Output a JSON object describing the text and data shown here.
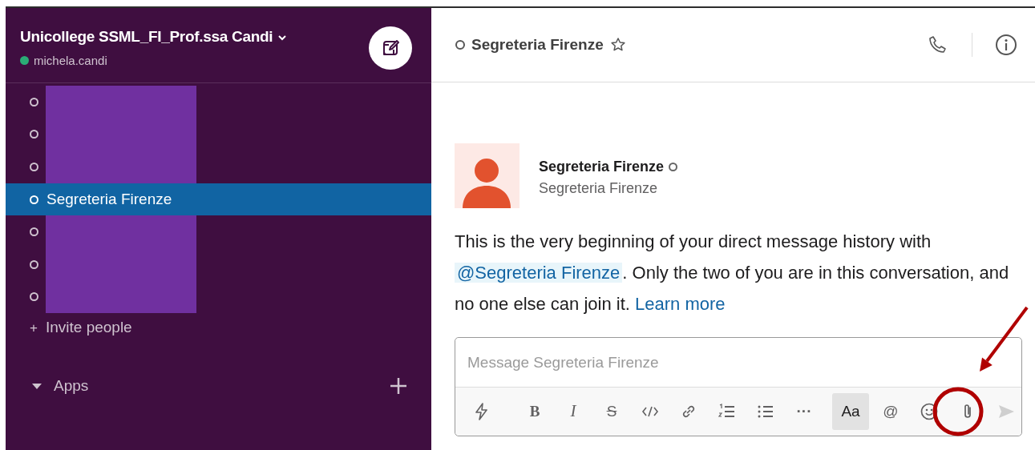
{
  "workspace": {
    "name": "Unicollege SSML_FI_Prof.ssa Candi",
    "user": "michela.candi",
    "online": true
  },
  "dm_items": [
    {
      "kind": "redacted",
      "selected": false
    },
    {
      "kind": "redacted",
      "selected": false
    },
    {
      "kind": "redacted",
      "selected": false
    },
    {
      "kind": "user",
      "name": "Segreteria Firenze",
      "selected": true
    },
    {
      "kind": "redacted",
      "selected": false
    },
    {
      "kind": "redacted",
      "selected": false
    },
    {
      "kind": "redacted",
      "selected": false
    }
  ],
  "invite": {
    "icon": "+",
    "label": "Invite people"
  },
  "apps": {
    "label": "Apps",
    "expanded": true
  },
  "channel_header": {
    "title": "Segreteria Firenze",
    "starred": false
  },
  "intro": {
    "name": "Segreteria Firenze",
    "subtitle": "Segreteria Firenze",
    "text_before": "This is the very beginning of your direct message history with",
    "mention": "@Segreteria Firenze",
    "text_after": ". Only the two of you are in this conversation, and no one else can join it.",
    "link": "Learn more"
  },
  "composer": {
    "placeholder": "Message Segreteria Firenze"
  },
  "toolbar": [
    {
      "kind": "shortcuts"
    },
    {
      "kind": "divider"
    },
    {
      "kind": "bold",
      "label": "B"
    },
    {
      "kind": "italic",
      "label": "I"
    },
    {
      "kind": "strike",
      "label": "S"
    },
    {
      "kind": "code"
    },
    {
      "kind": "link"
    },
    {
      "kind": "ordered-list"
    },
    {
      "kind": "bullet-list"
    },
    {
      "kind": "more",
      "label": "···"
    },
    {
      "kind": "format",
      "label": "Aa",
      "pressed": true
    },
    {
      "kind": "mention",
      "label": "@"
    },
    {
      "kind": "emoji"
    },
    {
      "kind": "attach",
      "highlighted": true
    },
    {
      "kind": "send",
      "disabled": true
    }
  ]
}
